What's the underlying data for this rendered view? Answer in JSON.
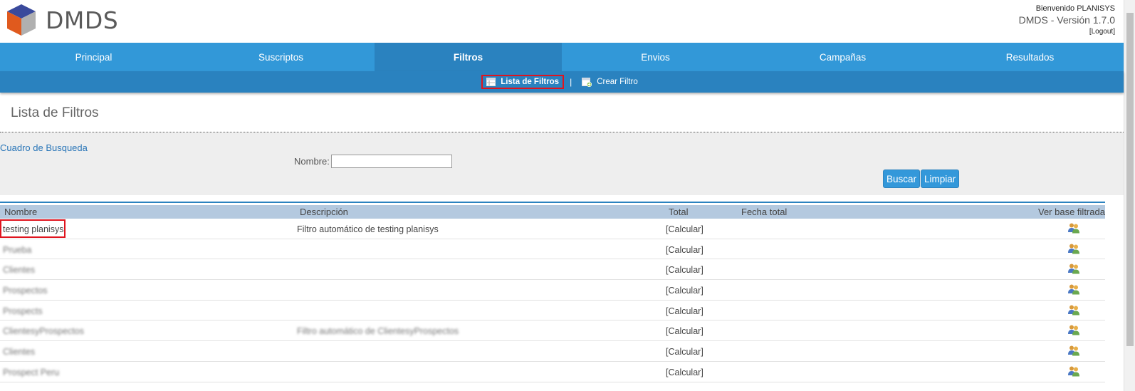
{
  "header": {
    "logo_text": "DMDS",
    "welcome": "Bienvenido PLANISYS",
    "version": "DMDS - Versión 1.7.0",
    "logout": "[Logout]"
  },
  "nav": {
    "items": [
      "Principal",
      "Suscriptos",
      "Filtros",
      "Envios",
      "Campañas",
      "Resultados"
    ],
    "active": "Filtros"
  },
  "subnav": {
    "lista": "Lista de Filtros",
    "crear": "Crear Filtro",
    "separator": "|"
  },
  "page_title": "Lista de Filtros",
  "search": {
    "title": "Cuadro de Busqueda",
    "nombre_label": "Nombre:",
    "nombre_value": "",
    "buscar": "Buscar",
    "limpiar": "Limpiar"
  },
  "table": {
    "headers": {
      "nombre": "Nombre",
      "descripcion": "Descripción",
      "total": "Total",
      "fecha_total": "Fecha total",
      "ver_base": "Ver base filtrada"
    },
    "rows": [
      {
        "nombre": "testing planisys",
        "descripcion": "Filtro automático de testing planisys",
        "total": "[Calcular]",
        "blurred": false
      },
      {
        "nombre": "Prueba",
        "descripcion": "",
        "total": "[Calcular]",
        "blurred": true
      },
      {
        "nombre": "Clientes",
        "descripcion": "",
        "total": "[Calcular]",
        "blurred": true
      },
      {
        "nombre": "Prospectos",
        "descripcion": "",
        "total": "[Calcular]",
        "blurred": true
      },
      {
        "nombre": "Prospects",
        "descripcion": "",
        "total": "[Calcular]",
        "blurred": true
      },
      {
        "nombre": "ClientesyProspectos",
        "descripcion": "Filtro automático de ClientesyProspectos",
        "total": "[Calcular]",
        "blurred": true
      },
      {
        "nombre": "Clientes",
        "descripcion": "",
        "total": "[Calcular]",
        "blurred": true
      },
      {
        "nombre": "Prospect Peru",
        "descripcion": "",
        "total": "[Calcular]",
        "blurred": true
      }
    ]
  },
  "icons": {
    "ver_base": "users-icon",
    "lista": "list-icon",
    "crear": "add-filter-icon"
  },
  "colors": {
    "nav": "#3298d8",
    "nav_active": "#2a82bf",
    "highlight": "#e0141e",
    "button": "#3398da"
  }
}
